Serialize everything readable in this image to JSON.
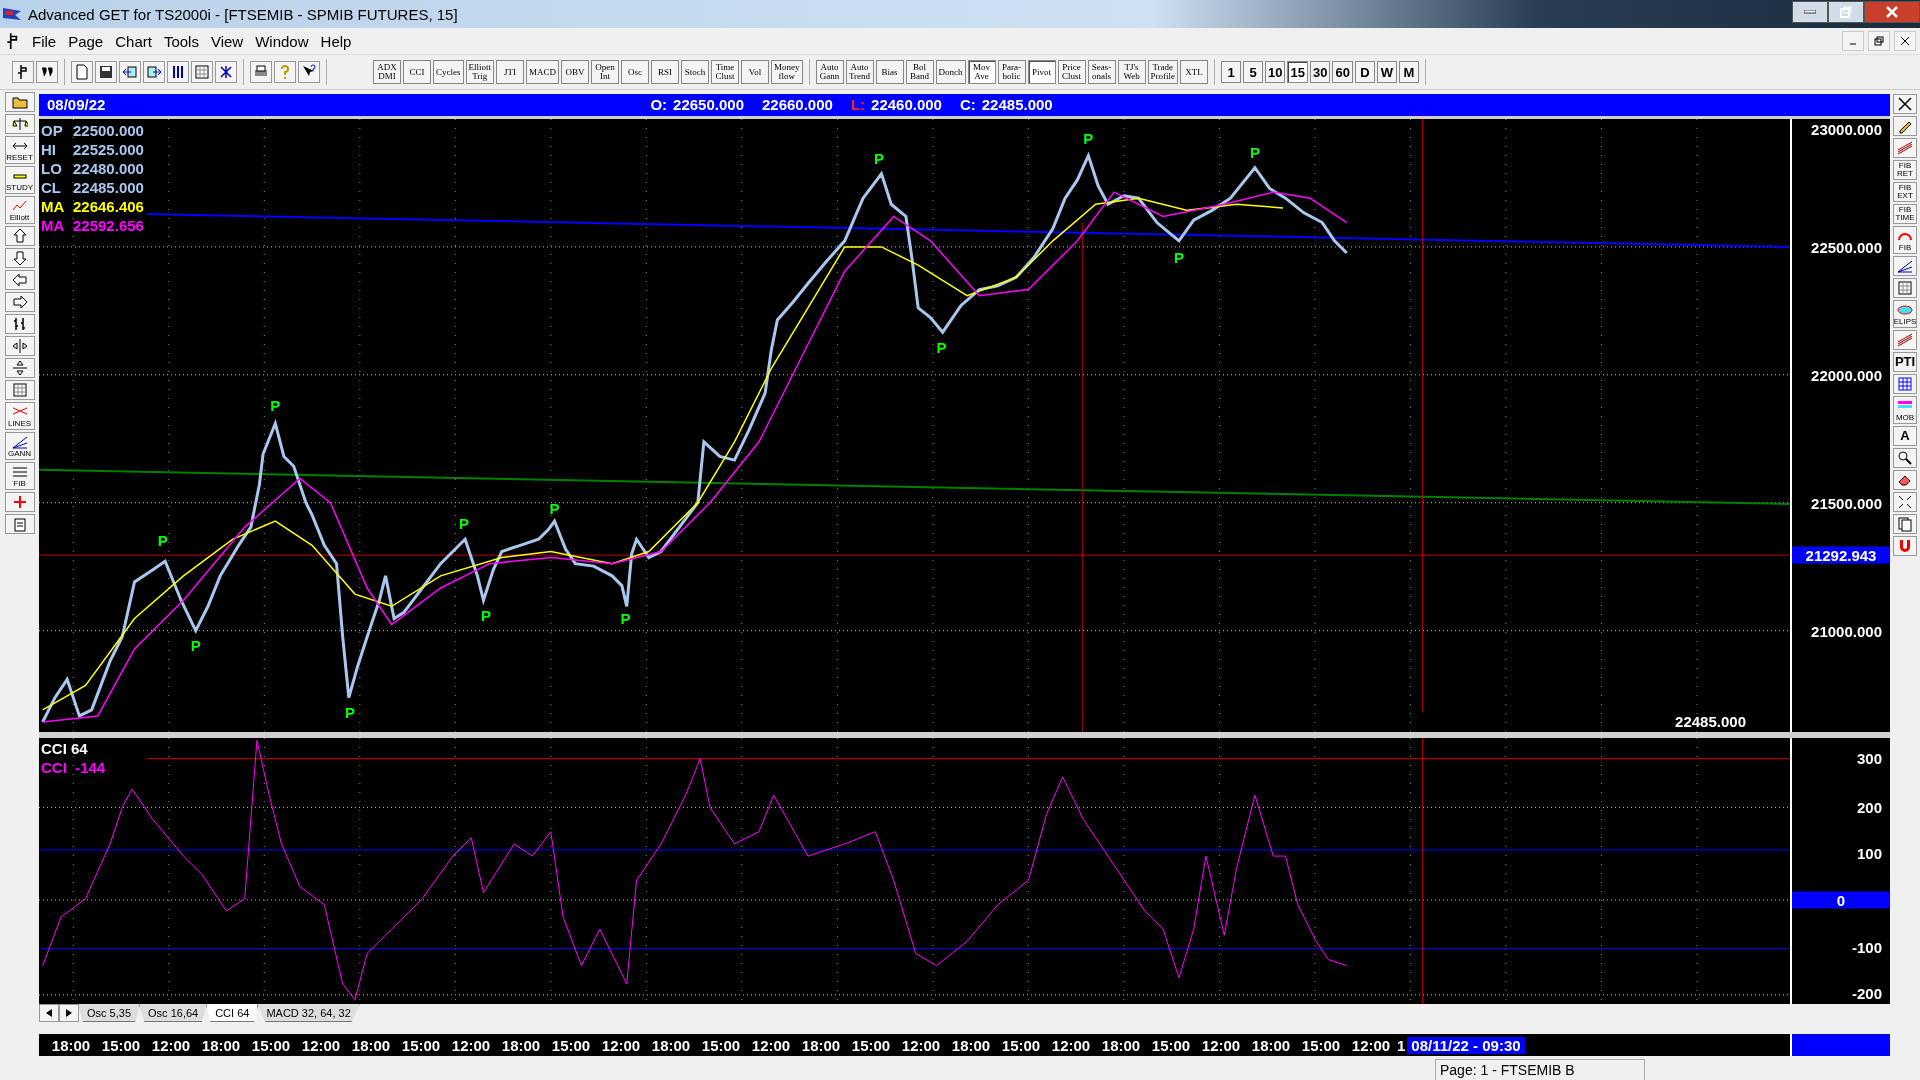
{
  "window": {
    "title": "Advanced GET for TS2000i - [FTSEMIB - SPMIB FUTURES, 15]"
  },
  "menu": [
    {
      "label": "File"
    },
    {
      "label": "Page"
    },
    {
      "label": "Chart"
    },
    {
      "label": "Tools"
    },
    {
      "label": "View"
    },
    {
      "label": "Window"
    },
    {
      "label": "Help"
    }
  ],
  "toolbar": {
    "tool_groups": [
      [
        {
          "kind": "cursor"
        },
        {
          "kind": "quote"
        }
      ],
      [
        {
          "kind": "document"
        },
        {
          "kind": "save"
        },
        {
          "kind": "import"
        },
        {
          "kind": "export"
        },
        {
          "kind": "columns"
        },
        {
          "kind": "grid"
        },
        {
          "kind": "network"
        }
      ],
      [
        {
          "kind": "printer"
        },
        {
          "kind": "bulb"
        },
        {
          "kind": "pointer"
        }
      ]
    ],
    "study_groups": [
      [
        {
          "lines": [
            "ADX",
            "DMI"
          ],
          "selected": false
        },
        {
          "lines": [
            "CCI"
          ],
          "selected": false
        },
        {
          "lines": [
            "Cycles"
          ],
          "selected": false
        },
        {
          "lines": [
            "Elliott",
            "Trig"
          ],
          "selected": false
        },
        {
          "lines": [
            "JTI"
          ],
          "selected": false
        },
        {
          "lines": [
            "MACD"
          ],
          "selected": false
        },
        {
          "lines": [
            "OBV"
          ],
          "selected": false
        },
        {
          "lines": [
            "Open",
            "Int"
          ],
          "selected": false
        },
        {
          "lines": [
            "Osc"
          ],
          "selected": false
        },
        {
          "lines": [
            "RSI"
          ],
          "selected": false
        },
        {
          "lines": [
            "Stoch"
          ],
          "selected": false
        },
        {
          "lines": [
            "Time",
            "Clust"
          ],
          "selected": false
        },
        {
          "lines": [
            "Vol"
          ],
          "selected": false
        },
        {
          "lines": [
            "Money",
            "flow"
          ],
          "selected": false
        }
      ],
      [
        {
          "lines": [
            "Auto",
            "Gann"
          ],
          "selected": false
        },
        {
          "lines": [
            "Auto",
            "Trend"
          ],
          "selected": false
        },
        {
          "lines": [
            "Bias"
          ],
          "selected": false
        },
        {
          "lines": [
            "Bol",
            "Band"
          ],
          "selected": false
        },
        {
          "lines": [
            "Donch"
          ],
          "selected": false
        },
        {
          "lines": [
            "Mov",
            "Ave"
          ],
          "selected": true
        },
        {
          "lines": [
            "Para-",
            "bolic"
          ],
          "selected": false
        },
        {
          "lines": [
            "Pivot"
          ],
          "selected": true
        },
        {
          "lines": [
            "Price",
            "Clust"
          ],
          "selected": false
        },
        {
          "lines": [
            "Seas-",
            "onals"
          ],
          "selected": false
        },
        {
          "lines": [
            "TJ's",
            "Web"
          ],
          "selected": false
        },
        {
          "lines": [
            "Trade",
            "Profile"
          ],
          "selected": false
        },
        {
          "lines": [
            "XTL"
          ],
          "selected": false
        }
      ]
    ],
    "intervals": [
      {
        "label": "1",
        "selected": false
      },
      {
        "label": "5",
        "selected": false
      },
      {
        "label": "10",
        "selected": false
      },
      {
        "label": "15",
        "selected": true
      },
      {
        "label": "30",
        "selected": false
      },
      {
        "label": "60",
        "selected": false
      },
      {
        "label": "D",
        "selected": false
      },
      {
        "label": "W",
        "selected": false
      },
      {
        "label": "M",
        "selected": false
      }
    ]
  },
  "left_tools": [
    {
      "kind": "folder"
    },
    {
      "kind": "scales"
    },
    {
      "kind": "arrows",
      "label": "RESET"
    },
    {
      "kind": "bar",
      "label": "STUDY"
    },
    {
      "kind": "wave",
      "label": "Elliott"
    },
    {
      "kind": "up"
    },
    {
      "kind": "down"
    },
    {
      "kind": "left"
    },
    {
      "kind": "right"
    },
    {
      "kind": "bars"
    },
    {
      "kind": "hsplit"
    },
    {
      "kind": "vsplit"
    },
    {
      "kind": "grid"
    },
    {
      "kind": "cross-lines",
      "label": "LINES"
    },
    {
      "kind": "fan",
      "label": "GANN"
    },
    {
      "kind": "rules",
      "label": "FIB"
    },
    {
      "kind": "crosshair"
    },
    {
      "kind": "clipboard"
    }
  ],
  "right_tools": [
    {
      "kind": "close"
    },
    {
      "kind": "pencil"
    },
    {
      "kind": "lines"
    },
    {
      "kind": "text",
      "label": "FIB RET"
    },
    {
      "kind": "text",
      "label": "FIB EXT"
    },
    {
      "kind": "text",
      "label": "FIB TIME"
    },
    {
      "kind": "arc",
      "label": "FIB"
    },
    {
      "kind": "fan"
    },
    {
      "kind": "grid"
    },
    {
      "kind": "ellipse",
      "label": "ELIPS"
    },
    {
      "kind": "lines"
    },
    {
      "kind": "text",
      "label": "PTI"
    },
    {
      "kind": "table"
    },
    {
      "kind": "stripes",
      "label": "MOB"
    },
    {
      "kind": "text",
      "label": "A"
    },
    {
      "kind": "zoom"
    },
    {
      "kind": "eraser"
    },
    {
      "kind": "expand"
    },
    {
      "kind": "pages"
    },
    {
      "kind": "magnet"
    }
  ],
  "chart": {
    "date": "08/09/22",
    "quotes": [
      {
        "label": "O:",
        "value": "22650.000",
        "highlight": false
      },
      {
        "value": "22660.000"
      },
      {
        "label": "L:",
        "value": "22460.000",
        "highlight": true
      },
      {
        "label": "C:",
        "value": "22485.000",
        "highlight": false
      }
    ],
    "legend": [
      {
        "label": "OP",
        "value": "22500.000",
        "color": "#a8c8f0"
      },
      {
        "label": "HI",
        "value": "22525.000",
        "color": "#a8c8f0"
      },
      {
        "label": "LO",
        "value": "22480.000",
        "color": "#a8c8f0"
      },
      {
        "label": "CL",
        "value": "22485.000",
        "color": "#a8c8f0"
      },
      {
        "label": "MA",
        "value": "22646.406",
        "color": "#ffff00"
      },
      {
        "label": "MA",
        "value": "22592.656",
        "color": "#ff00ff"
      }
    ],
    "pivots": [
      "P",
      "P",
      "P",
      "P",
      "P",
      "P",
      "P",
      "P",
      "P",
      "P",
      "P",
      "P",
      "P"
    ],
    "price_axis": [
      {
        "label": "23000.000",
        "highlight": false
      },
      {
        "label": "22500.000",
        "highlight": false
      },
      {
        "label": "22000.000",
        "highlight": false
      },
      {
        "label": "21500.000",
        "highlight": false
      },
      {
        "label": "21292.943",
        "highlight": true
      },
      {
        "label": "21000.000",
        "highlight": false
      }
    ],
    "last_close": "22485.000"
  },
  "cci": {
    "title": "CCI 64",
    "reading": {
      "label": "CCI",
      "value": "-144"
    },
    "axis": [
      {
        "label": "300",
        "highlight": false
      },
      {
        "label": "200",
        "highlight": false
      },
      {
        "label": "100",
        "highlight": false
      },
      {
        "label": "0",
        "highlight": true
      },
      {
        "label": "-100",
        "highlight": false
      },
      {
        "label": "-200",
        "highlight": false
      }
    ]
  },
  "tabs": [
    {
      "label": "Osc 5,35",
      "selected": false
    },
    {
      "label": "Osc 16,64",
      "selected": false
    },
    {
      "label": "CCI 64",
      "selected": true
    },
    {
      "label": "MACD 32, 64, 32",
      "selected": false
    }
  ],
  "time_axis": {
    "labels": [
      "18:00",
      "15:00",
      "12:00",
      "18:00",
      "15:00",
      "12:00",
      "18:00",
      "15:00",
      "12:00",
      "18:00",
      "15:00",
      "12:00",
      "18:00",
      "15:00",
      "12:00",
      "18:00",
      "15:00",
      "12:00",
      "18:00",
      "15:00",
      "12:00",
      "18:00",
      "15:00",
      "12:00",
      "18:00",
      "15:00",
      "12:00",
      "1"
    ],
    "cursor": "08/11/22 - 09:30"
  },
  "status_bar": "Page: 1 - FTSEMIB B"
}
